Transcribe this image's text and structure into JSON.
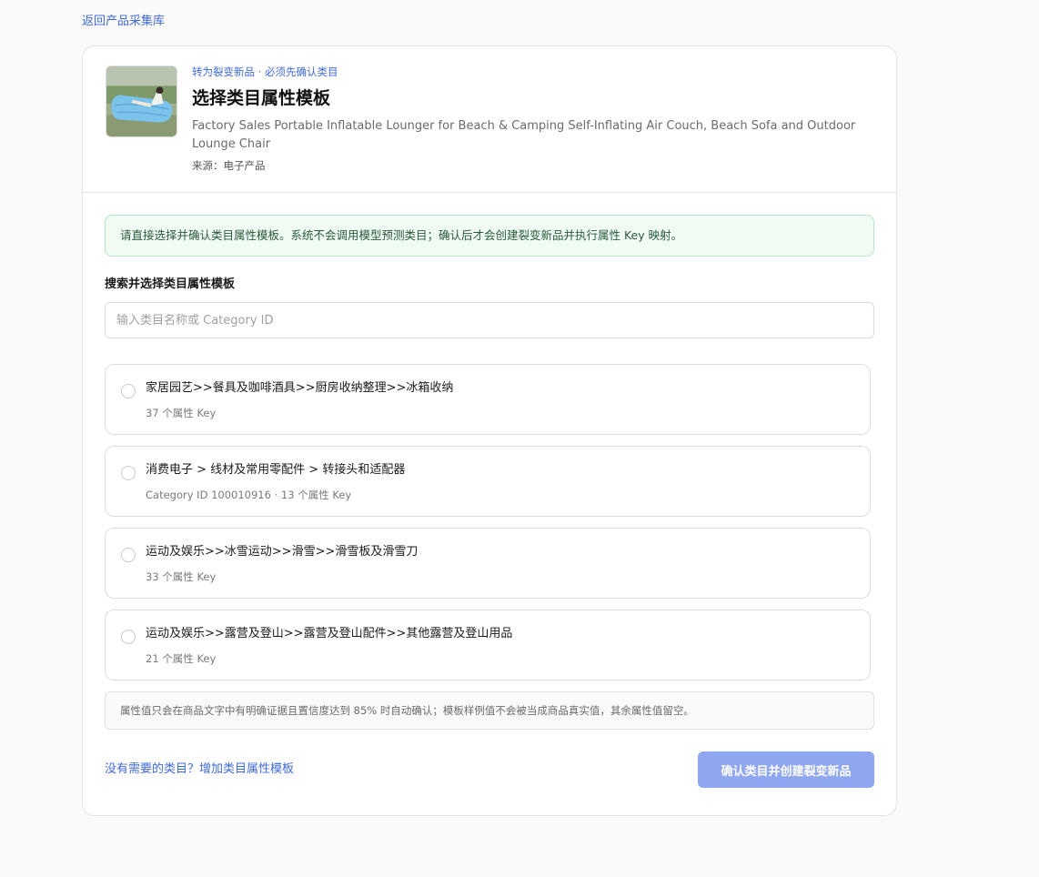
{
  "nav": {
    "back_label": "返回产品采集库"
  },
  "product": {
    "eyebrow": "转为裂变新品 · 必须先确认类目",
    "title": "选择类目属性模板",
    "name": "Factory Sales Portable Inflatable Lounger for Beach & Camping Self-Inflating Air Couch, Beach Sofa and Outdoor Lounge Chair",
    "source": "来源：电子产品",
    "thumbnail_icon": "inflatable-lounger-photo"
  },
  "notice": "请直接选择并确认类目属性模板。系统不会调用模型预测类目；确认后才会创建裂变新品并执行属性 Key 映射。",
  "search": {
    "label": "搜索并选择类目属性模板",
    "placeholder": "输入类目名称或 Category ID",
    "value": ""
  },
  "categories": [
    {
      "title": "家居园艺>>餐具及咖啡酒具>>厨房收纳整理>>冰箱收纳",
      "meta": "37 个属性 Key"
    },
    {
      "title": "消费电子 > 线材及常用零配件 > 转接头和适配器",
      "meta": "Category ID 100010916 · 13 个属性 Key"
    },
    {
      "title": "运动及娱乐>>冰雪运动>>滑雪>>滑雪板及滑雪刀",
      "meta": "33 个属性 Key"
    },
    {
      "title": "运动及娱乐>>露营及登山>>露营及登山配件>>其他露营及登山用品",
      "meta": "21 个属性 Key"
    }
  ],
  "footnote": "属性值只会在商品文字中有明确证据且置信度达到 85% 时自动确认；模板样例值不会被当成商品真实值，其余属性值留空。",
  "footer": {
    "add_link": "没有需要的类目？增加类目属性模板",
    "confirm_label": "确认类目并创建裂变新品"
  },
  "colors": {
    "accent": "#3f6ad8",
    "button_disabled": "#8fa6f0",
    "notice_bg": "#effbf3",
    "notice_border": "#b7e5c7"
  }
}
